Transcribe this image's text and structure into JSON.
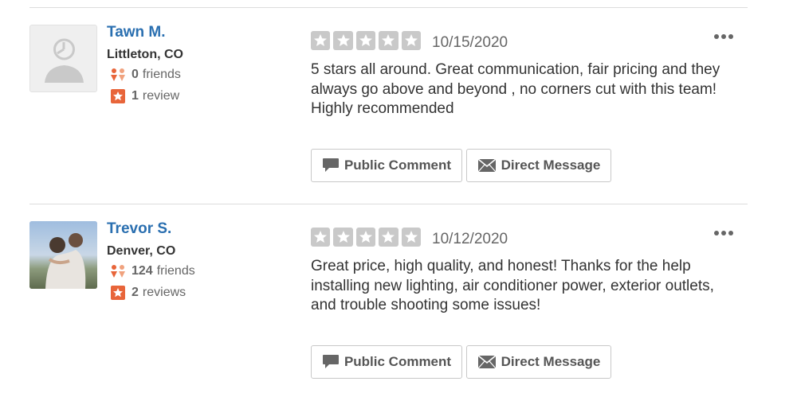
{
  "reviews": [
    {
      "user": {
        "name": "Tawn M.",
        "location": "Littleton, CO",
        "friends_count": "0",
        "friends_label": "friends",
        "review_count": "1",
        "review_label": "review",
        "avatar": "default-avatar"
      },
      "rating": 5,
      "date": "10/15/2020",
      "text": "5 stars all around. Great communication, fair pricing and they always go above and beyond , no corners cut with this team! Highly recommended",
      "actions": {
        "comment_label": "Public Comment",
        "message_label": "Direct Message"
      }
    },
    {
      "user": {
        "name": "Trevor S.",
        "location": "Denver, CO",
        "friends_count": "124",
        "friends_label": "friends",
        "review_count": "2",
        "review_label": "reviews",
        "avatar": "user-photo"
      },
      "rating": 5,
      "date": "10/12/2020",
      "text": "Great price, high quality, and honest!  Thanks for the help installing new lighting, air conditioner power, exterior outlets, and trouble shooting some issues!",
      "actions": {
        "comment_label": "Public Comment",
        "message_label": "Direct Message"
      }
    }
  ],
  "icons": {
    "friends": "friends-icon",
    "review": "review-star-icon",
    "comment": "speech-bubble-icon",
    "message": "envelope-icon",
    "more": "more-options-icon"
  },
  "colors": {
    "name_link": "#2a6fb0",
    "star_empty": "#c9c9c9",
    "accent_orange": "#e8653a"
  }
}
